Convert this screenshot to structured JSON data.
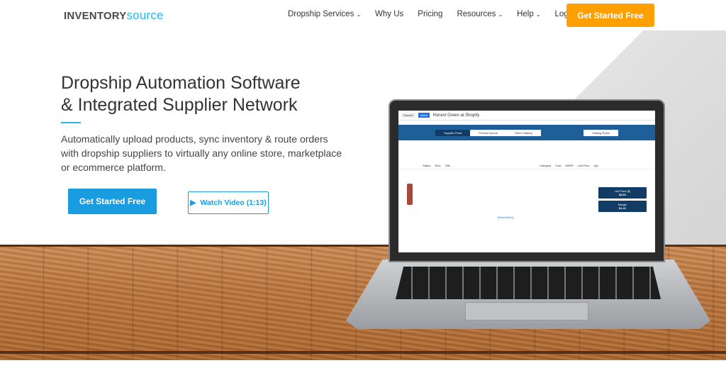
{
  "header": {
    "logo_part1": "INVENTORY",
    "logo_part2": "source",
    "nav": [
      {
        "label": "Dropship Services",
        "dropdown": true
      },
      {
        "label": "Why Us",
        "dropdown": false
      },
      {
        "label": "Pricing",
        "dropdown": false
      },
      {
        "label": "Resources",
        "dropdown": true
      },
      {
        "label": "Help",
        "dropdown": true
      },
      {
        "label": "Login",
        "dropdown": false
      }
    ],
    "cta": "Get Started Free"
  },
  "hero": {
    "title_line1": "Dropship Automation Software",
    "title_line2": "& Integrated Supplier Network",
    "subtitle": "Automatically upload products, sync inventory & route orders with dropship suppliers to virtually any online store, marketplace or ecommerce platform.",
    "primary_button": "Get Started Free",
    "video_button": "Watch Video (1:13)"
  },
  "screen": {
    "paused": "Paused",
    "active": "Active",
    "store": "Honest Green at Shopify",
    "tabs": [
      "Supplier Feed",
      "Product Queue",
      "Store Catalog"
    ],
    "catalog_rules": "Catalog Rules",
    "columns": [
      "Status",
      "SKU",
      "Title",
      "Category",
      "Cost",
      "MSRP",
      "List Price",
      "Qty"
    ],
    "list_price_label": "List Price ($)",
    "list_price": "$8.84",
    "margin_label": "Margin",
    "margin": "$1.41",
    "read_more": "[Read More]"
  },
  "colors": {
    "accent": "#2bb3e6",
    "cta_orange": "#ffa000",
    "button_blue": "#1a9ce0"
  }
}
